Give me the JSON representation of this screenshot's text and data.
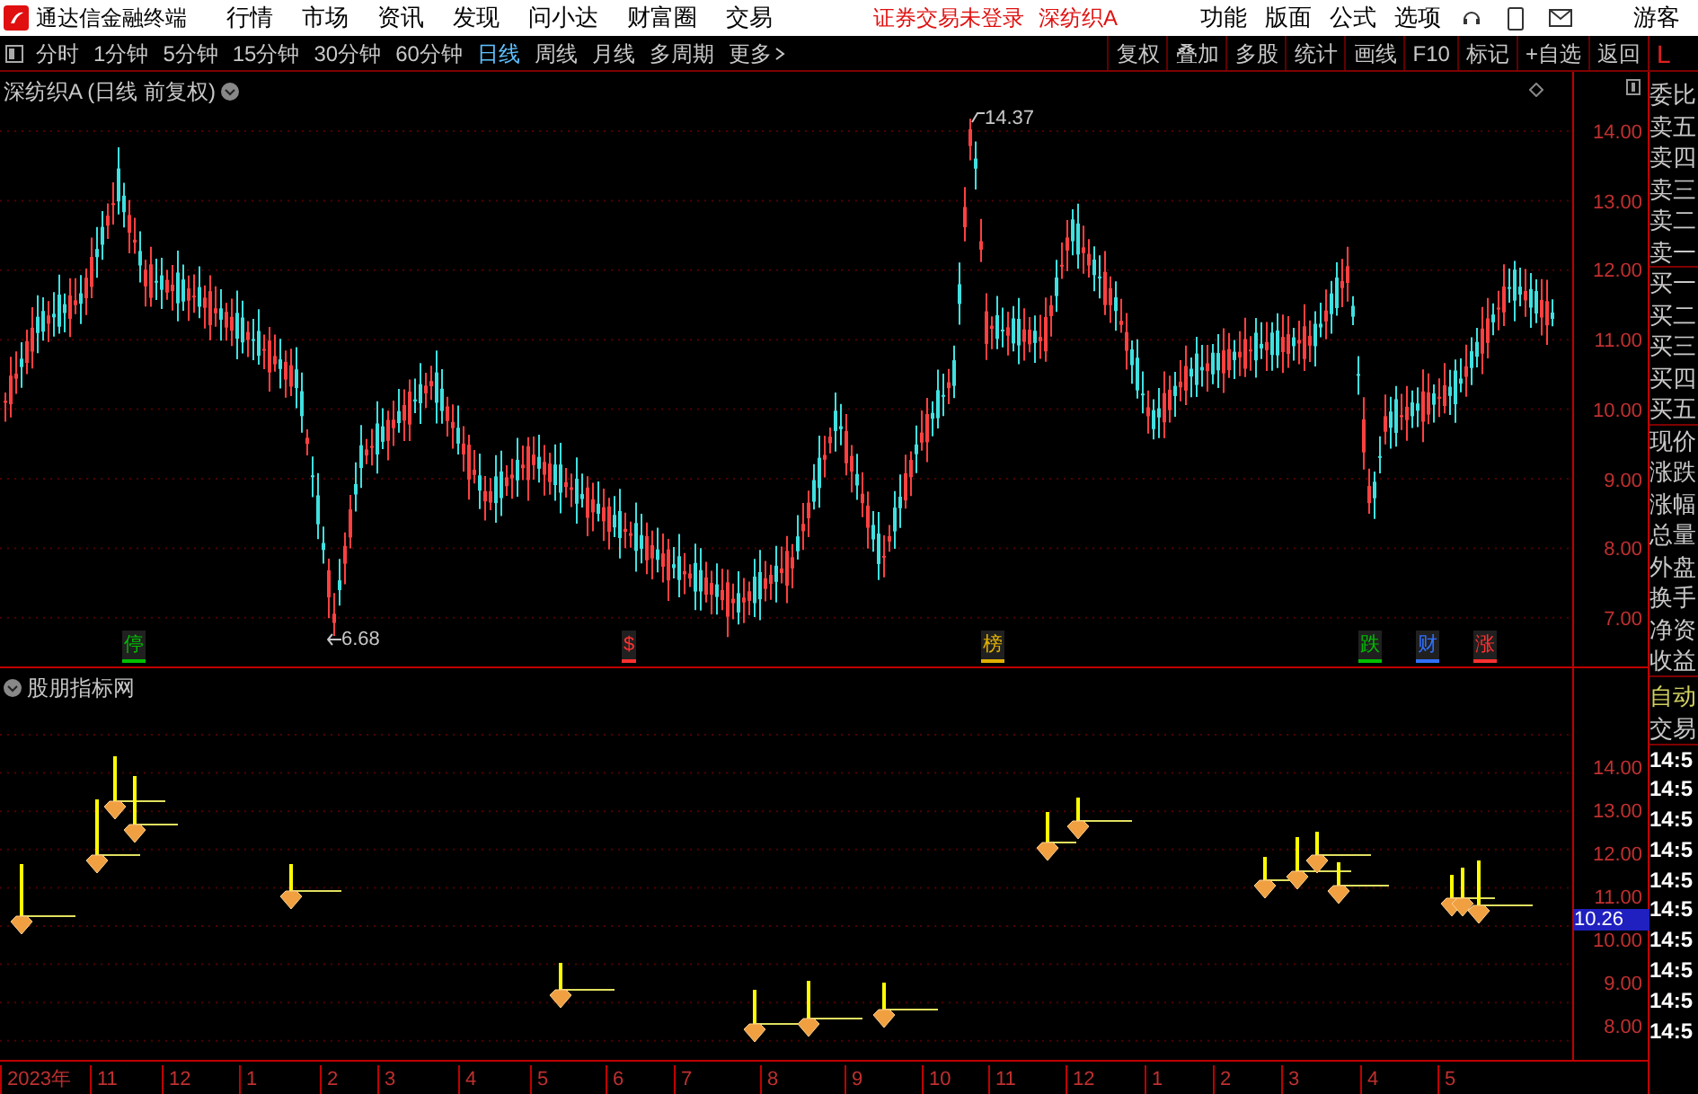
{
  "title_bar": {
    "app_name": "通达信金融终端",
    "menu": [
      "行情",
      "市场",
      "资讯",
      "发现",
      "问小达",
      "财富圈",
      "交易"
    ],
    "login_status": "证券交易未登录",
    "stock": "深纺织A",
    "right_menu": [
      "功能",
      "版面",
      "公式",
      "选项"
    ],
    "user": "游客"
  },
  "toolbar": {
    "periods": [
      {
        "label": "分时",
        "selected": false
      },
      {
        "label": "1分钟",
        "selected": false
      },
      {
        "label": "5分钟",
        "selected": false
      },
      {
        "label": "15分钟",
        "selected": false
      },
      {
        "label": "30分钟",
        "selected": false
      },
      {
        "label": "60分钟",
        "selected": false
      },
      {
        "label": "日线",
        "selected": true
      },
      {
        "label": "周线",
        "selected": false
      },
      {
        "label": "月线",
        "selected": false
      },
      {
        "label": "多周期",
        "selected": false
      }
    ],
    "more": "更多",
    "buttons": [
      "复权",
      "叠加",
      "多股",
      "统计",
      "画线",
      "F10",
      "标记",
      "+自选",
      "返回"
    ],
    "side_tab": "L"
  },
  "main_chart": {
    "title": "深纺织A (日线 前复权)",
    "price_axis": [
      "14.00",
      "13.00",
      "12.00",
      "11.00",
      "10.00",
      "9.00",
      "8.00",
      "7.00"
    ],
    "annotations": [
      {
        "kind": "high",
        "text": "14.37"
      },
      {
        "kind": "low",
        "text": "6.68"
      }
    ],
    "event_tags": [
      {
        "text": "停",
        "color": "#00c000"
      },
      {
        "text": "$",
        "color": "#ff3030"
      },
      {
        "text": "榜",
        "color": "#e0b000"
      },
      {
        "text": "跌",
        "color": "#00c000"
      },
      {
        "text": "财",
        "color": "#3070ff"
      },
      {
        "text": "涨",
        "color": "#ff3030"
      }
    ]
  },
  "indicator": {
    "title": "股朋指标网",
    "price_axis": [
      "14.00",
      "13.00",
      "12.00",
      "11.00",
      "10.00",
      "9.00",
      "8.00"
    ],
    "current_price": "10.26"
  },
  "time_axis": [
    "2023年",
    "11",
    "12",
    "1",
    "2",
    "3",
    "4",
    "5",
    "6",
    "7",
    "8",
    "9",
    "10",
    "11",
    "12",
    "1",
    "2",
    "3",
    "4",
    "5"
  ],
  "quote_panel": {
    "labels": [
      "委比",
      "卖五",
      "卖四",
      "卖三",
      "卖二",
      "卖一",
      "买一",
      "买二",
      "买三",
      "买四",
      "买五",
      "现价",
      "涨跌",
      "涨幅",
      "总量",
      "外盘",
      "换手",
      "净资",
      "收益"
    ],
    "mode": "自动",
    "trade": "交易",
    "times": [
      "14:5",
      "14:5",
      "14:5",
      "14:5",
      "14:5",
      "14:5",
      "14:5",
      "14:5",
      "14:5",
      "14:5"
    ]
  }
}
